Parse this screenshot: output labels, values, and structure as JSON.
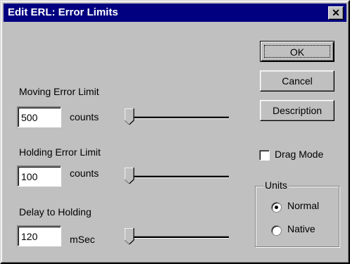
{
  "dialog": {
    "title": "Edit ERL:  Error Limits",
    "close_label": "✕"
  },
  "params": [
    {
      "label": "Moving Error Limit",
      "value": "500",
      "unit": "counts",
      "slider_level": 0
    },
    {
      "label": "Holding Error Limit",
      "value": "100",
      "unit": "counts",
      "slider_level": 0
    },
    {
      "label": "Delay to Holding",
      "value": "120",
      "unit": "mSec",
      "slider_level": 0
    }
  ],
  "buttons": {
    "ok": "OK",
    "cancel": "Cancel",
    "description": "Description"
  },
  "drag_mode": {
    "label": "Drag Mode",
    "checked": false
  },
  "units": {
    "legend": "Units",
    "options": [
      {
        "label": "Normal",
        "selected": true
      },
      {
        "label": "Native",
        "selected": false
      }
    ]
  }
}
